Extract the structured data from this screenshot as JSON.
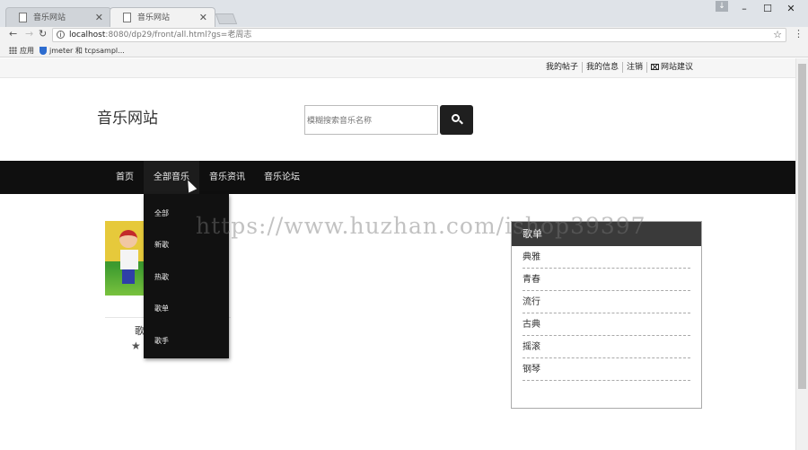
{
  "browser": {
    "tabs": [
      {
        "title": "音乐网站"
      },
      {
        "title": "音乐网站"
      }
    ],
    "url_host": "localhost",
    "url_rest": ":8080/dp29/front/all.html?gs=老周志",
    "bookmarks": {
      "apps": "应用",
      "jmeter": "jmeter 和 tcpsampl..."
    },
    "window_controls": {
      "minimize": "–",
      "maximize": "☐",
      "close": "✕"
    }
  },
  "topbar": {
    "links": [
      "我的帖子",
      "我的信息",
      "注销",
      "网站建议"
    ]
  },
  "header": {
    "logo": "音乐网站",
    "search_placeholder": "模糊搜索音乐名称"
  },
  "nav": {
    "items": [
      "首页",
      "全部音乐",
      "音乐资讯",
      "音乐论坛"
    ],
    "active": "全部音乐"
  },
  "dropdown": {
    "items": [
      "全部",
      "新歌",
      "热歌",
      "歌单",
      "歌手"
    ]
  },
  "album": {
    "title": "歌",
    "rating": "★"
  },
  "category_panel": {
    "title": "歌单",
    "items": [
      "典雅",
      "青春",
      "流行",
      "古典",
      "摇滚",
      "钢琴"
    ]
  },
  "watermark": "https://www.huzhan.com/ishop39397",
  "colors": {
    "navbar_bg": "#0f0f0f",
    "panel_header_bg": "#3a3a3a",
    "search_button_bg": "#1f1f1f"
  }
}
